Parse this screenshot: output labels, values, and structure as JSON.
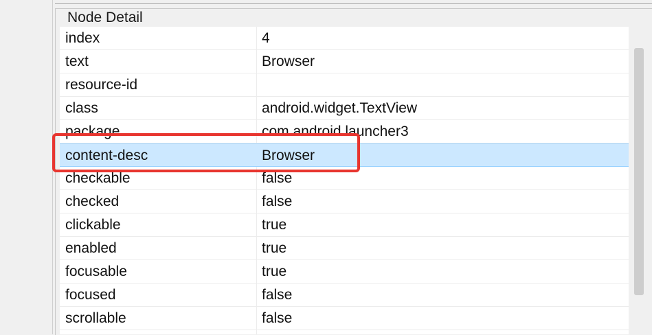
{
  "panel": {
    "title": "Node Detail"
  },
  "rows": [
    {
      "key": "index",
      "value": "4"
    },
    {
      "key": "text",
      "value": "Browser"
    },
    {
      "key": "resource-id",
      "value": ""
    },
    {
      "key": "class",
      "value": "android.widget.TextView"
    },
    {
      "key": "package",
      "value": "com.android.launcher3"
    },
    {
      "key": "content-desc",
      "value": "Browser"
    },
    {
      "key": "checkable",
      "value": "false"
    },
    {
      "key": "checked",
      "value": "false"
    },
    {
      "key": "clickable",
      "value": "true"
    },
    {
      "key": "enabled",
      "value": "true"
    },
    {
      "key": "focusable",
      "value": "true"
    },
    {
      "key": "focused",
      "value": "false"
    },
    {
      "key": "scrollable",
      "value": "false"
    }
  ],
  "selected_row": "content-desc",
  "colors": {
    "selection": "#cce8ff",
    "highlight": "#e8352f"
  }
}
